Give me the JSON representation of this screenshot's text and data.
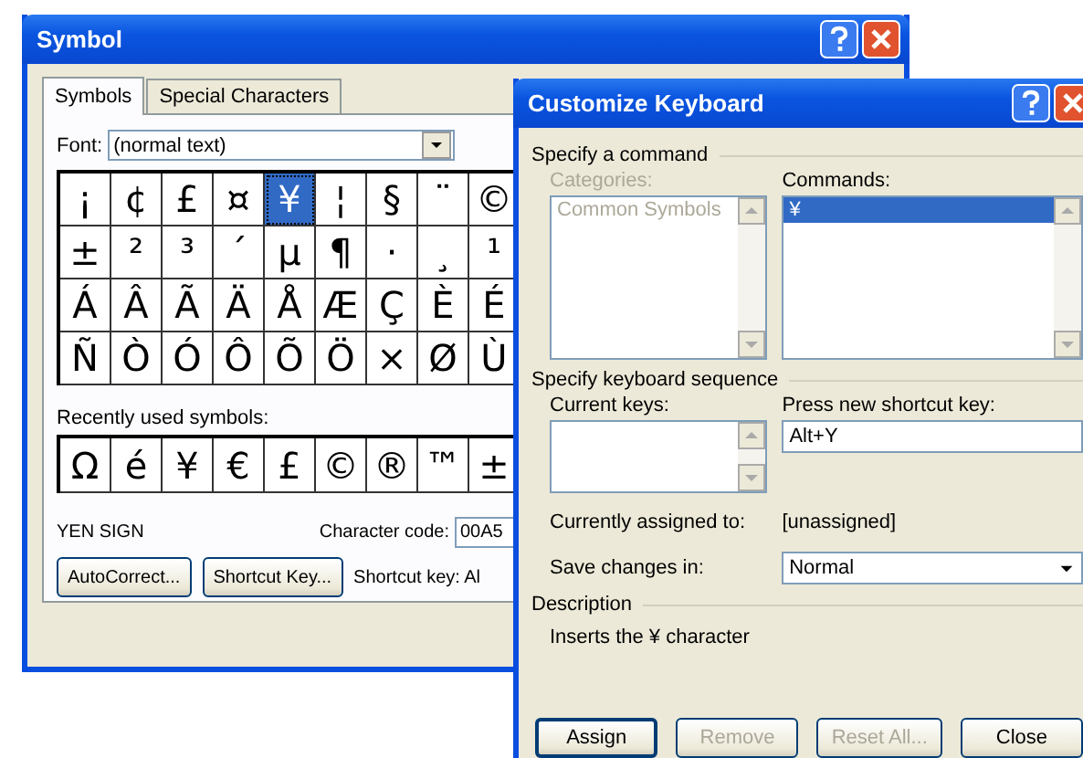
{
  "symbol_window": {
    "title": "Symbol",
    "tabs": [
      {
        "label": "Symbols",
        "selected": true
      },
      {
        "label": "Special Characters",
        "selected": false
      }
    ],
    "font": {
      "label": "Font:",
      "value": "(normal text)"
    },
    "symbol_grid": [
      [
        {
          "char": "¡",
          "selected": false
        },
        {
          "char": "¢",
          "selected": false
        },
        {
          "char": "£",
          "selected": false
        },
        {
          "char": "¤",
          "selected": false
        },
        {
          "char": "¥",
          "selected": true
        },
        {
          "char": "¦",
          "selected": false
        },
        {
          "char": "§",
          "selected": false
        },
        {
          "char": "¨",
          "selected": false
        },
        {
          "char": "©",
          "selected": false
        }
      ],
      [
        {
          "char": "±",
          "selected": false
        },
        {
          "char": "²",
          "selected": false
        },
        {
          "char": "³",
          "selected": false
        },
        {
          "char": "´",
          "selected": false
        },
        {
          "char": "µ",
          "selected": false
        },
        {
          "char": "¶",
          "selected": false
        },
        {
          "char": "·",
          "selected": false
        },
        {
          "char": "¸",
          "selected": false
        },
        {
          "char": "¹",
          "selected": false
        }
      ],
      [
        {
          "char": "Á",
          "selected": false
        },
        {
          "char": "Â",
          "selected": false
        },
        {
          "char": "Ã",
          "selected": false
        },
        {
          "char": "Ä",
          "selected": false
        },
        {
          "char": "Å",
          "selected": false
        },
        {
          "char": "Æ",
          "selected": false
        },
        {
          "char": "Ç",
          "selected": false
        },
        {
          "char": "È",
          "selected": false
        },
        {
          "char": "É",
          "selected": false
        }
      ],
      [
        {
          "char": "Ñ",
          "selected": false
        },
        {
          "char": "Ò",
          "selected": false
        },
        {
          "char": "Ó",
          "selected": false
        },
        {
          "char": "Ô",
          "selected": false
        },
        {
          "char": "Õ",
          "selected": false
        },
        {
          "char": "Ö",
          "selected": false
        },
        {
          "char": "×",
          "selected": false
        },
        {
          "char": "Ø",
          "selected": false
        },
        {
          "char": "Ù",
          "selected": false
        }
      ]
    ],
    "recent_label": "Recently used symbols:",
    "recent": [
      "Ω",
      "é",
      "¥",
      "€",
      "£",
      "©",
      "®",
      "™",
      "±"
    ],
    "char_name": "YEN SIGN",
    "char_code": {
      "label": "Character code:",
      "value": "00A5"
    },
    "buttons": [
      "AutoCorrect...",
      "Shortcut Key..."
    ],
    "shortcut_text": "Shortcut key: Al"
  },
  "customize_window": {
    "title": "Customize Keyboard",
    "command_section": "Specify a command",
    "categories": {
      "label": "Categories:",
      "disabled": true,
      "items": [
        "Common Symbols"
      ]
    },
    "commands": {
      "label": "Commands:",
      "items": [
        {
          "label": "¥",
          "selected": true
        }
      ]
    },
    "sequence_section": "Specify keyboard sequence",
    "current_keys": {
      "label": "Current keys:"
    },
    "new_key": {
      "label": "Press new shortcut key:",
      "value": "Alt+Y"
    },
    "assigned": {
      "label": "Currently assigned to:",
      "value": "[unassigned]"
    },
    "save_in": {
      "label": "Save changes in:",
      "value": "Normal"
    },
    "description_section": "Description",
    "description": "Inserts the ¥ character",
    "buttons": [
      {
        "label": "Assign",
        "disabled": false
      },
      {
        "label": "Remove",
        "disabled": true
      },
      {
        "label": "Reset All...",
        "disabled": true
      },
      {
        "label": "Close",
        "disabled": false
      }
    ]
  }
}
